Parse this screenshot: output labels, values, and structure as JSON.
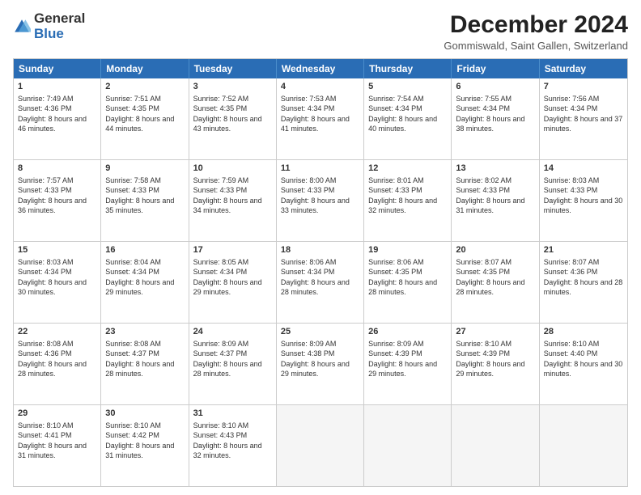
{
  "header": {
    "logo_general": "General",
    "logo_blue": "Blue",
    "month_title": "December 2024",
    "location": "Gommiswald, Saint Gallen, Switzerland"
  },
  "weekdays": [
    "Sunday",
    "Monday",
    "Tuesday",
    "Wednesday",
    "Thursday",
    "Friday",
    "Saturday"
  ],
  "rows": [
    [
      {
        "day": "1",
        "sunrise": "Sunrise: 7:49 AM",
        "sunset": "Sunset: 4:36 PM",
        "daylight": "Daylight: 8 hours and 46 minutes."
      },
      {
        "day": "2",
        "sunrise": "Sunrise: 7:51 AM",
        "sunset": "Sunset: 4:35 PM",
        "daylight": "Daylight: 8 hours and 44 minutes."
      },
      {
        "day": "3",
        "sunrise": "Sunrise: 7:52 AM",
        "sunset": "Sunset: 4:35 PM",
        "daylight": "Daylight: 8 hours and 43 minutes."
      },
      {
        "day": "4",
        "sunrise": "Sunrise: 7:53 AM",
        "sunset": "Sunset: 4:34 PM",
        "daylight": "Daylight: 8 hours and 41 minutes."
      },
      {
        "day": "5",
        "sunrise": "Sunrise: 7:54 AM",
        "sunset": "Sunset: 4:34 PM",
        "daylight": "Daylight: 8 hours and 40 minutes."
      },
      {
        "day": "6",
        "sunrise": "Sunrise: 7:55 AM",
        "sunset": "Sunset: 4:34 PM",
        "daylight": "Daylight: 8 hours and 38 minutes."
      },
      {
        "day": "7",
        "sunrise": "Sunrise: 7:56 AM",
        "sunset": "Sunset: 4:34 PM",
        "daylight": "Daylight: 8 hours and 37 minutes."
      }
    ],
    [
      {
        "day": "8",
        "sunrise": "Sunrise: 7:57 AM",
        "sunset": "Sunset: 4:33 PM",
        "daylight": "Daylight: 8 hours and 36 minutes."
      },
      {
        "day": "9",
        "sunrise": "Sunrise: 7:58 AM",
        "sunset": "Sunset: 4:33 PM",
        "daylight": "Daylight: 8 hours and 35 minutes."
      },
      {
        "day": "10",
        "sunrise": "Sunrise: 7:59 AM",
        "sunset": "Sunset: 4:33 PM",
        "daylight": "Daylight: 8 hours and 34 minutes."
      },
      {
        "day": "11",
        "sunrise": "Sunrise: 8:00 AM",
        "sunset": "Sunset: 4:33 PM",
        "daylight": "Daylight: 8 hours and 33 minutes."
      },
      {
        "day": "12",
        "sunrise": "Sunrise: 8:01 AM",
        "sunset": "Sunset: 4:33 PM",
        "daylight": "Daylight: 8 hours and 32 minutes."
      },
      {
        "day": "13",
        "sunrise": "Sunrise: 8:02 AM",
        "sunset": "Sunset: 4:33 PM",
        "daylight": "Daylight: 8 hours and 31 minutes."
      },
      {
        "day": "14",
        "sunrise": "Sunrise: 8:03 AM",
        "sunset": "Sunset: 4:33 PM",
        "daylight": "Daylight: 8 hours and 30 minutes."
      }
    ],
    [
      {
        "day": "15",
        "sunrise": "Sunrise: 8:03 AM",
        "sunset": "Sunset: 4:34 PM",
        "daylight": "Daylight: 8 hours and 30 minutes."
      },
      {
        "day": "16",
        "sunrise": "Sunrise: 8:04 AM",
        "sunset": "Sunset: 4:34 PM",
        "daylight": "Daylight: 8 hours and 29 minutes."
      },
      {
        "day": "17",
        "sunrise": "Sunrise: 8:05 AM",
        "sunset": "Sunset: 4:34 PM",
        "daylight": "Daylight: 8 hours and 29 minutes."
      },
      {
        "day": "18",
        "sunrise": "Sunrise: 8:06 AM",
        "sunset": "Sunset: 4:34 PM",
        "daylight": "Daylight: 8 hours and 28 minutes."
      },
      {
        "day": "19",
        "sunrise": "Sunrise: 8:06 AM",
        "sunset": "Sunset: 4:35 PM",
        "daylight": "Daylight: 8 hours and 28 minutes."
      },
      {
        "day": "20",
        "sunrise": "Sunrise: 8:07 AM",
        "sunset": "Sunset: 4:35 PM",
        "daylight": "Daylight: 8 hours and 28 minutes."
      },
      {
        "day": "21",
        "sunrise": "Sunrise: 8:07 AM",
        "sunset": "Sunset: 4:36 PM",
        "daylight": "Daylight: 8 hours and 28 minutes."
      }
    ],
    [
      {
        "day": "22",
        "sunrise": "Sunrise: 8:08 AM",
        "sunset": "Sunset: 4:36 PM",
        "daylight": "Daylight: 8 hours and 28 minutes."
      },
      {
        "day": "23",
        "sunrise": "Sunrise: 8:08 AM",
        "sunset": "Sunset: 4:37 PM",
        "daylight": "Daylight: 8 hours and 28 minutes."
      },
      {
        "day": "24",
        "sunrise": "Sunrise: 8:09 AM",
        "sunset": "Sunset: 4:37 PM",
        "daylight": "Daylight: 8 hours and 28 minutes."
      },
      {
        "day": "25",
        "sunrise": "Sunrise: 8:09 AM",
        "sunset": "Sunset: 4:38 PM",
        "daylight": "Daylight: 8 hours and 29 minutes."
      },
      {
        "day": "26",
        "sunrise": "Sunrise: 8:09 AM",
        "sunset": "Sunset: 4:39 PM",
        "daylight": "Daylight: 8 hours and 29 minutes."
      },
      {
        "day": "27",
        "sunrise": "Sunrise: 8:10 AM",
        "sunset": "Sunset: 4:39 PM",
        "daylight": "Daylight: 8 hours and 29 minutes."
      },
      {
        "day": "28",
        "sunrise": "Sunrise: 8:10 AM",
        "sunset": "Sunset: 4:40 PM",
        "daylight": "Daylight: 8 hours and 30 minutes."
      }
    ],
    [
      {
        "day": "29",
        "sunrise": "Sunrise: 8:10 AM",
        "sunset": "Sunset: 4:41 PM",
        "daylight": "Daylight: 8 hours and 31 minutes."
      },
      {
        "day": "30",
        "sunrise": "Sunrise: 8:10 AM",
        "sunset": "Sunset: 4:42 PM",
        "daylight": "Daylight: 8 hours and 31 minutes."
      },
      {
        "day": "31",
        "sunrise": "Sunrise: 8:10 AM",
        "sunset": "Sunset: 4:43 PM",
        "daylight": "Daylight: 8 hours and 32 minutes."
      },
      null,
      null,
      null,
      null
    ]
  ]
}
